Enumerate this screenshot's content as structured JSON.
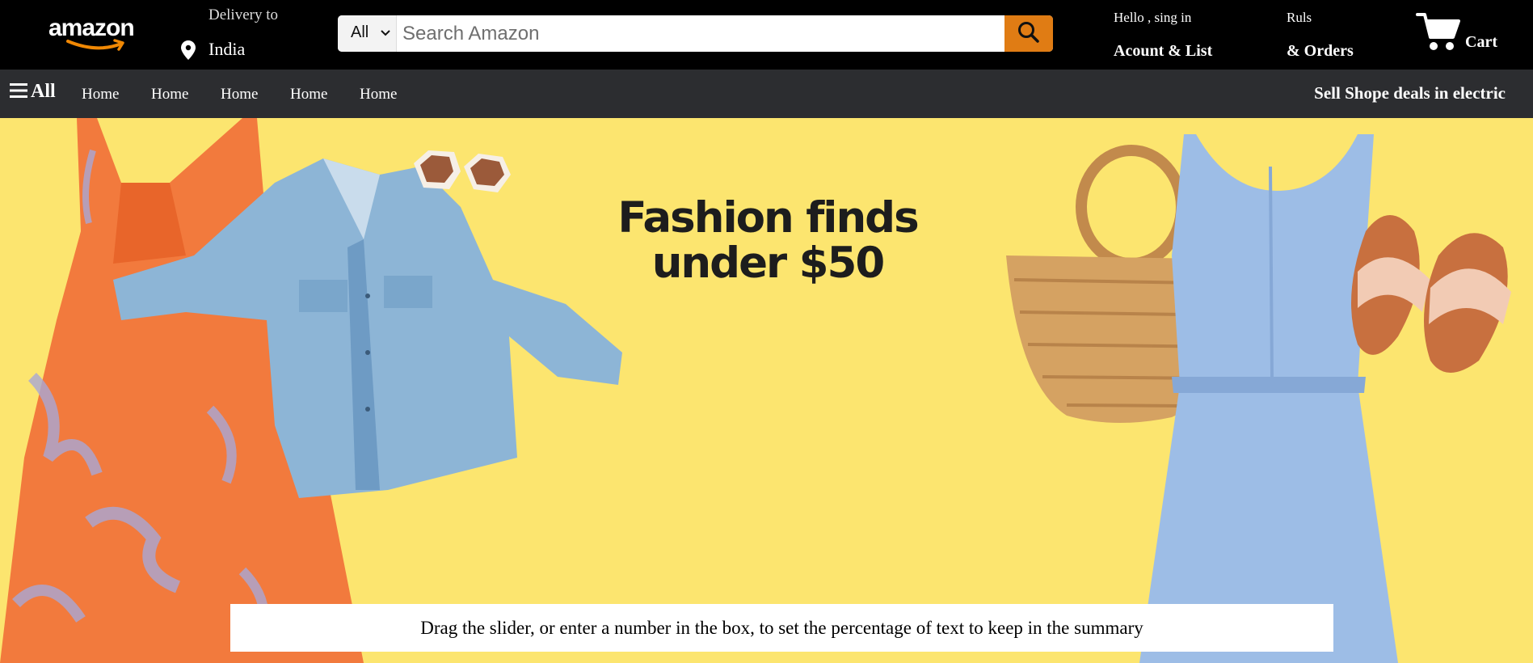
{
  "logo": {
    "text": "amazon"
  },
  "delivery": {
    "label": "Delivery to",
    "location": "India"
  },
  "search": {
    "category": "All",
    "placeholder": "Search Amazon"
  },
  "account": {
    "greeting": "Hello , sing in",
    "label": "Acount & List"
  },
  "orders": {
    "small": "Ruls",
    "label": "& Orders"
  },
  "cart": {
    "label": "Cart"
  },
  "nav": {
    "all_label": "All",
    "items": [
      "Home",
      "Home",
      "Home",
      "Home",
      "Home"
    ],
    "right_text": "Sell Shope deals in electric"
  },
  "hero": {
    "title_line1": "Fashion finds",
    "title_line2": "under $50"
  },
  "caption": "Drag the slider, or enter a number in the box, to set the percentage of text to keep in the summary",
  "colors": {
    "topbar": "#000000",
    "navbar": "#2c2d30",
    "search_button": "#e07c14",
    "hero_background": "#fce56f"
  },
  "icons": [
    "location-pin-icon",
    "chevron-down-icon",
    "search-icon",
    "cart-icon",
    "hamburger-menu-icon"
  ]
}
